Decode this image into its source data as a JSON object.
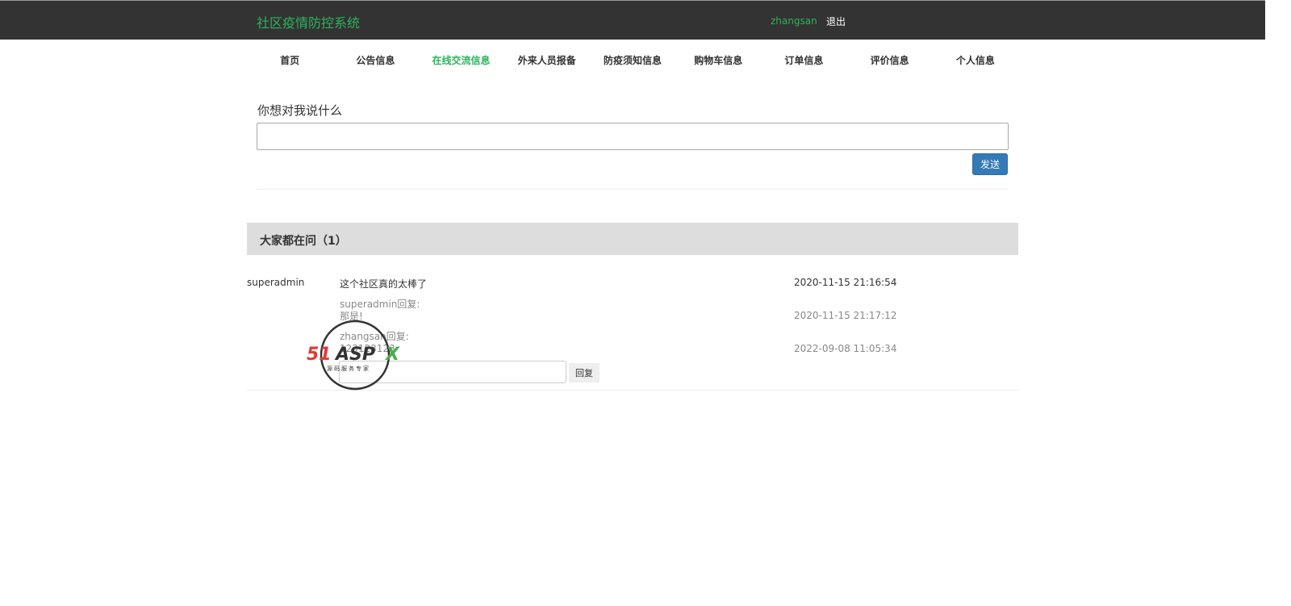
{
  "header": {
    "brand": "社区疫情防控系统",
    "username": "zhangsan",
    "logout": "退出"
  },
  "nav": [
    "首页",
    "公告信息",
    "在线交流信息",
    "外来人员报备",
    "防疫须知信息",
    "购物车信息",
    "订单信息",
    "评价信息",
    "个人信息"
  ],
  "nav_active": 2,
  "form": {
    "label": "你想对我说什么",
    "value": "",
    "send": "发送"
  },
  "questions": {
    "title": "大家都在问（1）",
    "items": [
      {
        "user": "superadmin",
        "content": "这个社区真的太棒了",
        "time": "2020-11-15 21:16:54",
        "replies": [
          {
            "who": "superadmin回复:",
            "text": "那是!",
            "time": "2020-11-15 21:17:12"
          },
          {
            "who": "zhangsan回复:",
            "text": "123123123",
            "time": "2022-09-08 11:05:34"
          }
        ],
        "reply_value": "",
        "reply_button": "回复"
      }
    ]
  },
  "watermark": {
    "brand": "51ASPX",
    "tagline": "源码服务专家"
  },
  "colors": {
    "accent": "#2db35c",
    "header": "#333333",
    "primary": "#337ab7"
  }
}
